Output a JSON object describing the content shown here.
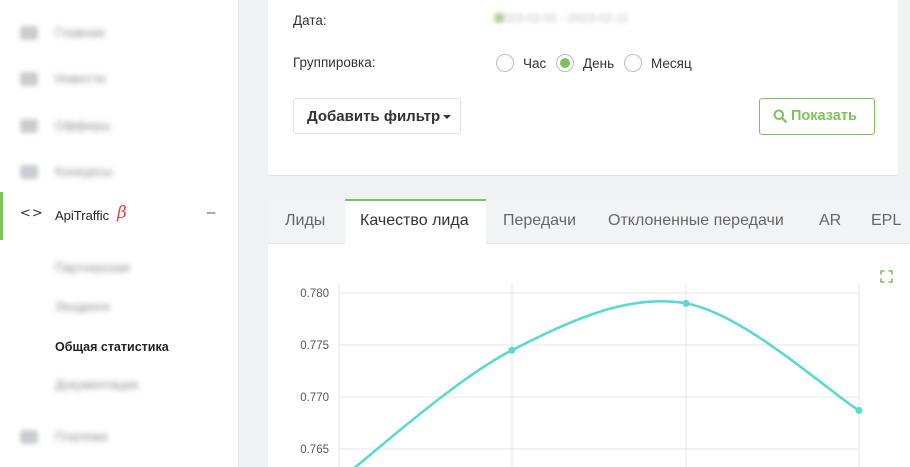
{
  "sidebar": {
    "items_top": [
      {
        "label": "Главная",
        "icon": "home-icon"
      },
      {
        "label": "Новости",
        "icon": "news-icon"
      },
      {
        "label": "Офферы",
        "icon": "offers-icon"
      },
      {
        "label": "Конкурсы",
        "icon": "contest-icon"
      }
    ],
    "active_group": {
      "label": "ApiTraffic",
      "beta": "β",
      "icon": "code-icon",
      "collapse": "–",
      "subitems": [
        {
          "label": "Партнерская"
        },
        {
          "label": "Лендинги"
        },
        {
          "label": "Общая статистика"
        },
        {
          "label": "Документация"
        }
      ]
    },
    "items_bottom": [
      {
        "label": "Платежи",
        "icon": "payments-icon"
      }
    ]
  },
  "filters": {
    "date_label": "Дата:",
    "date_value": "2023-02-01 - 2023-02-11",
    "grouping_label": "Группировка:",
    "grouping_options": [
      {
        "label": "Час",
        "checked": false
      },
      {
        "label": "День",
        "checked": true
      },
      {
        "label": "Месяц",
        "checked": false
      }
    ],
    "add_filter_label": "Добавить фильтр",
    "show_label": "Показать"
  },
  "tabs": [
    {
      "label": "Лиды",
      "active": false
    },
    {
      "label": "Качество лида",
      "active": true
    },
    {
      "label": "Передачи",
      "active": false
    },
    {
      "label": "Отклоненные передачи",
      "active": false
    },
    {
      "label": "AR",
      "active": false
    },
    {
      "label": "EPL",
      "active": false
    }
  ],
  "colors": {
    "accent": "#7cc35c",
    "line": "#5dd8d0",
    "beta": "#e4453a"
  },
  "chart_data": {
    "type": "line",
    "y_ticks": [
      "0.780",
      "0.775",
      "0.770",
      "0.765"
    ],
    "ylim": [
      0.7635,
      0.7808
    ],
    "series": [
      {
        "values": [
          0.762,
          0.7745,
          0.779,
          0.7687
        ],
        "smooth": true
      }
    ],
    "grid": true,
    "title": "",
    "xlabel": "",
    "ylabel": ""
  }
}
